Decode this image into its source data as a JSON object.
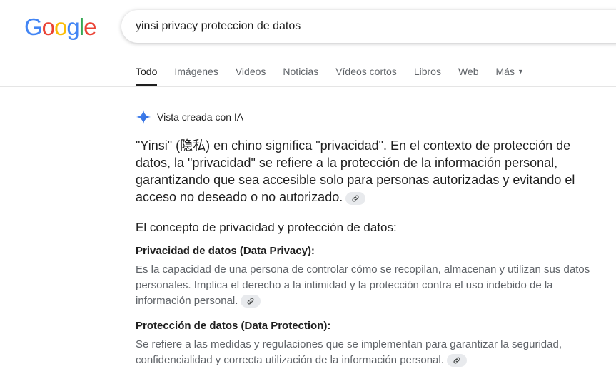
{
  "logo": {
    "letters": [
      "G",
      "o",
      "o",
      "g",
      "l",
      "e"
    ],
    "colors": [
      "#4285F4",
      "#EA4335",
      "#FBBC05",
      "#4285F4",
      "#34A853",
      "#EA4335"
    ]
  },
  "search": {
    "query": "yinsi privacy proteccion de datos"
  },
  "tabs": [
    {
      "label": "Todo",
      "active": true
    },
    {
      "label": "Imágenes"
    },
    {
      "label": "Videos"
    },
    {
      "label": "Noticias"
    },
    {
      "label": "Vídeos cortos"
    },
    {
      "label": "Libros"
    },
    {
      "label": "Web"
    },
    {
      "label": "Más"
    }
  ],
  "ai_overview": {
    "header": "Vista creada con IA",
    "icon": "sparkle-icon",
    "summary": "\"Yinsi\" (隐私) en chino significa \"privacidad\". En el contexto de protección de datos, la \"privacidad\" se refiere a la protección de la información personal, garantizando que sea accesible solo para personas autorizadas y evitando el acceso no deseado o no autorizado.",
    "section_title": "El concepto de privacidad y protección de datos:",
    "items": [
      {
        "title": "Privacidad de datos (Data Privacy):",
        "text": "Es la capacidad de una persona de controlar cómo se recopilan, almacenan y utilizan sus datos personales. Implica el derecho a la intimidad y la protección contra el uso indebido de la información personal."
      },
      {
        "title": "Protección de datos (Data Protection):",
        "text": "Se refiere a las medidas y regulaciones que se implementan para garantizar la seguridad, confidencialidad y correcta utilización de la información personal."
      }
    ]
  }
}
